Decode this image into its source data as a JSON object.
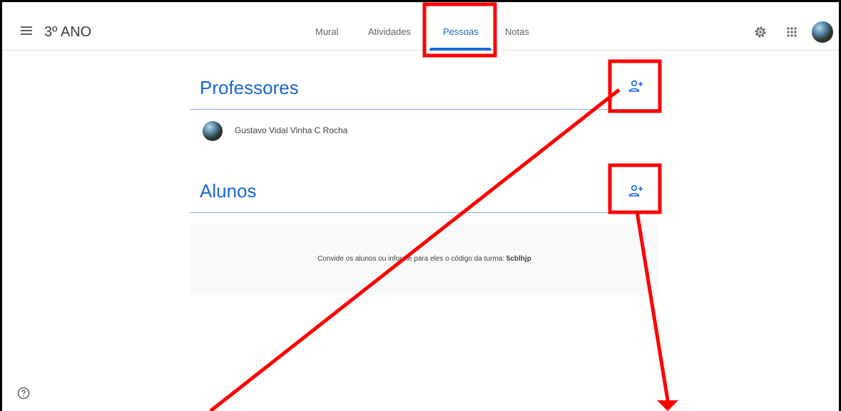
{
  "header": {
    "class_name": "3º ANO",
    "tabs": [
      {
        "label": "Mural",
        "active": false
      },
      {
        "label": "Atividades",
        "active": false
      },
      {
        "label": "Pessoas",
        "active": true
      },
      {
        "label": "Notas",
        "active": false
      }
    ],
    "icons": [
      "menu-icon",
      "settings-icon",
      "apps-grid-icon",
      "user-avatar"
    ]
  },
  "teachers": {
    "title": "Professores",
    "members": [
      {
        "name": "Gustavo Vidal Vinha C Rocha"
      }
    ]
  },
  "students": {
    "title": "Alunos",
    "invite_text": "Convide os alunos ou informe para eles o código da turma: ",
    "class_code": "5cblhjp"
  },
  "colors": {
    "accent": "#1967d2",
    "annotation": "#ff0000",
    "text": "#3c4043"
  }
}
